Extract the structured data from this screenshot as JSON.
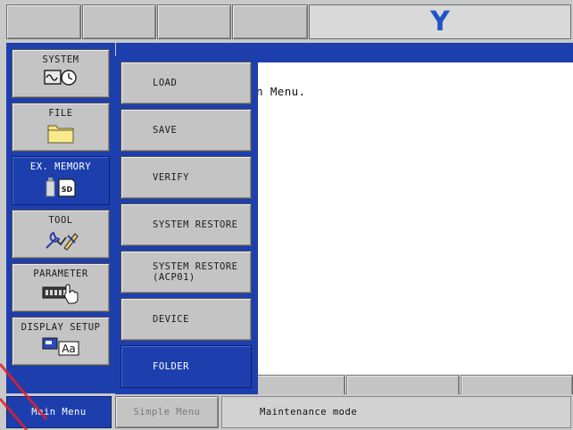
{
  "header": {
    "logo_text": "Y",
    "logo_color": "#1f55c6"
  },
  "main_menu": {
    "items": [
      {
        "label": "SYSTEM",
        "icon": "system-wave-clock-icon",
        "selected": false
      },
      {
        "label": "FILE",
        "icon": "folder-icon",
        "selected": false
      },
      {
        "label": "EX. MEMORY",
        "icon": "usb-sd-card-icon",
        "selected": true
      },
      {
        "label": "TOOL",
        "icon": "tool-wrench-icon",
        "selected": false
      },
      {
        "label": "PARAMETER",
        "icon": "parameter-hand-icon",
        "selected": false
      },
      {
        "label": "DISPLAY SETUP",
        "icon": "display-font-icon",
        "selected": false
      }
    ]
  },
  "submenu": {
    "items": [
      {
        "lines": [
          "LOAD"
        ],
        "selected": false
      },
      {
        "lines": [
          "SAVE"
        ],
        "selected": false
      },
      {
        "lines": [
          "VERIFY"
        ],
        "selected": false
      },
      {
        "lines": [
          "SYSTEM RESTORE"
        ],
        "selected": false
      },
      {
        "lines": [
          "SYSTEM RESTORE",
          "(ACP01)"
        ],
        "selected": false
      },
      {
        "lines": [
          "DEVICE"
        ],
        "selected": false
      },
      {
        "lines": [
          "FOLDER"
        ],
        "selected": true
      }
    ]
  },
  "main_panel": {
    "message": "n Menu."
  },
  "status_bar": {
    "main_menu_label": "Main Menu",
    "simple_menu_label": "Simple Menu",
    "message": "Maintenance mode"
  },
  "colors": {
    "accent_blue": "#1d3fae",
    "button_gray": "#c4c4c4"
  }
}
